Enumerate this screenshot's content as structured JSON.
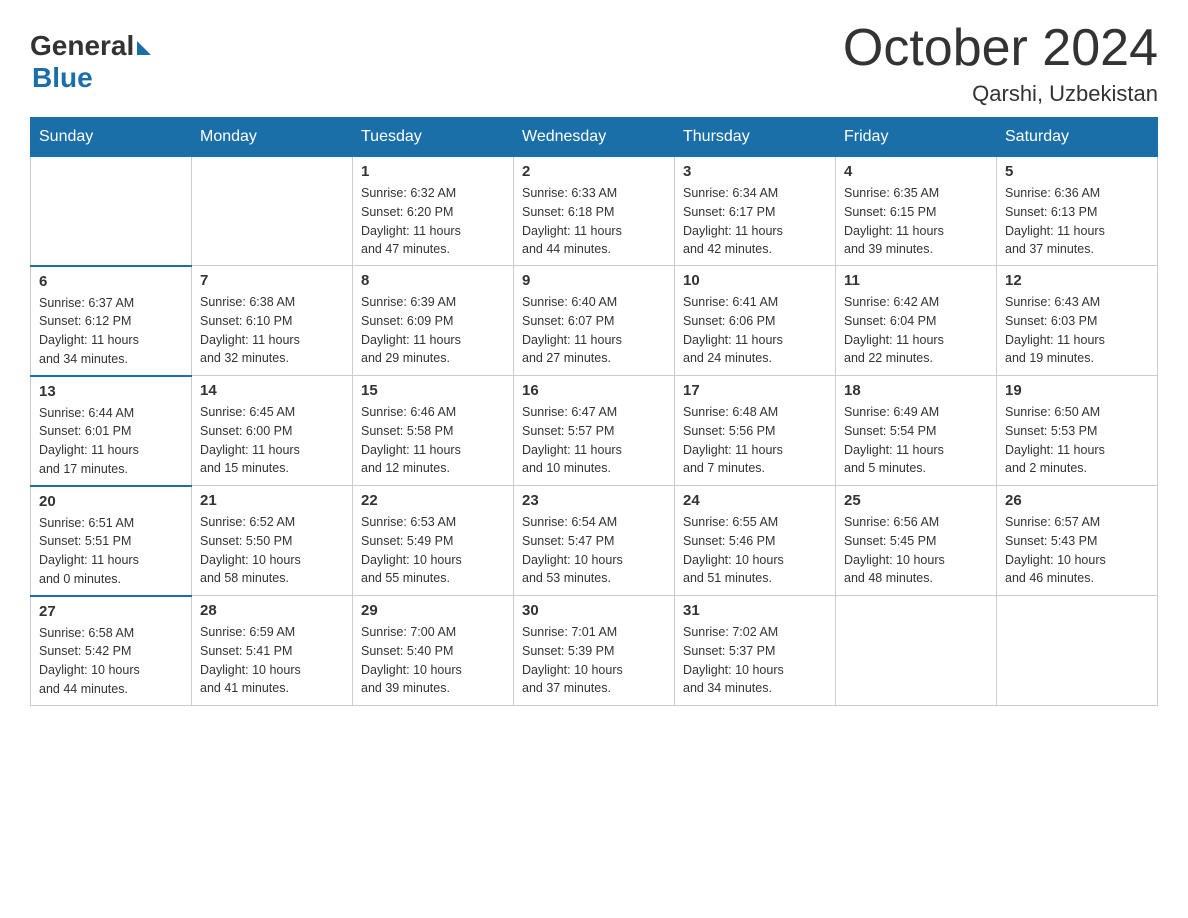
{
  "header": {
    "logo_general": "General",
    "logo_blue": "Blue",
    "month_title": "October 2024",
    "location": "Qarshi, Uzbekistan"
  },
  "days_of_week": [
    "Sunday",
    "Monday",
    "Tuesday",
    "Wednesday",
    "Thursday",
    "Friday",
    "Saturday"
  ],
  "weeks": [
    [
      {
        "day": "",
        "info": ""
      },
      {
        "day": "",
        "info": ""
      },
      {
        "day": "1",
        "info": "Sunrise: 6:32 AM\nSunset: 6:20 PM\nDaylight: 11 hours\nand 47 minutes."
      },
      {
        "day": "2",
        "info": "Sunrise: 6:33 AM\nSunset: 6:18 PM\nDaylight: 11 hours\nand 44 minutes."
      },
      {
        "day": "3",
        "info": "Sunrise: 6:34 AM\nSunset: 6:17 PM\nDaylight: 11 hours\nand 42 minutes."
      },
      {
        "day": "4",
        "info": "Sunrise: 6:35 AM\nSunset: 6:15 PM\nDaylight: 11 hours\nand 39 minutes."
      },
      {
        "day": "5",
        "info": "Sunrise: 6:36 AM\nSunset: 6:13 PM\nDaylight: 11 hours\nand 37 minutes."
      }
    ],
    [
      {
        "day": "6",
        "info": "Sunrise: 6:37 AM\nSunset: 6:12 PM\nDaylight: 11 hours\nand 34 minutes."
      },
      {
        "day": "7",
        "info": "Sunrise: 6:38 AM\nSunset: 6:10 PM\nDaylight: 11 hours\nand 32 minutes."
      },
      {
        "day": "8",
        "info": "Sunrise: 6:39 AM\nSunset: 6:09 PM\nDaylight: 11 hours\nand 29 minutes."
      },
      {
        "day": "9",
        "info": "Sunrise: 6:40 AM\nSunset: 6:07 PM\nDaylight: 11 hours\nand 27 minutes."
      },
      {
        "day": "10",
        "info": "Sunrise: 6:41 AM\nSunset: 6:06 PM\nDaylight: 11 hours\nand 24 minutes."
      },
      {
        "day": "11",
        "info": "Sunrise: 6:42 AM\nSunset: 6:04 PM\nDaylight: 11 hours\nand 22 minutes."
      },
      {
        "day": "12",
        "info": "Sunrise: 6:43 AM\nSunset: 6:03 PM\nDaylight: 11 hours\nand 19 minutes."
      }
    ],
    [
      {
        "day": "13",
        "info": "Sunrise: 6:44 AM\nSunset: 6:01 PM\nDaylight: 11 hours\nand 17 minutes."
      },
      {
        "day": "14",
        "info": "Sunrise: 6:45 AM\nSunset: 6:00 PM\nDaylight: 11 hours\nand 15 minutes."
      },
      {
        "day": "15",
        "info": "Sunrise: 6:46 AM\nSunset: 5:58 PM\nDaylight: 11 hours\nand 12 minutes."
      },
      {
        "day": "16",
        "info": "Sunrise: 6:47 AM\nSunset: 5:57 PM\nDaylight: 11 hours\nand 10 minutes."
      },
      {
        "day": "17",
        "info": "Sunrise: 6:48 AM\nSunset: 5:56 PM\nDaylight: 11 hours\nand 7 minutes."
      },
      {
        "day": "18",
        "info": "Sunrise: 6:49 AM\nSunset: 5:54 PM\nDaylight: 11 hours\nand 5 minutes."
      },
      {
        "day": "19",
        "info": "Sunrise: 6:50 AM\nSunset: 5:53 PM\nDaylight: 11 hours\nand 2 minutes."
      }
    ],
    [
      {
        "day": "20",
        "info": "Sunrise: 6:51 AM\nSunset: 5:51 PM\nDaylight: 11 hours\nand 0 minutes."
      },
      {
        "day": "21",
        "info": "Sunrise: 6:52 AM\nSunset: 5:50 PM\nDaylight: 10 hours\nand 58 minutes."
      },
      {
        "day": "22",
        "info": "Sunrise: 6:53 AM\nSunset: 5:49 PM\nDaylight: 10 hours\nand 55 minutes."
      },
      {
        "day": "23",
        "info": "Sunrise: 6:54 AM\nSunset: 5:47 PM\nDaylight: 10 hours\nand 53 minutes."
      },
      {
        "day": "24",
        "info": "Sunrise: 6:55 AM\nSunset: 5:46 PM\nDaylight: 10 hours\nand 51 minutes."
      },
      {
        "day": "25",
        "info": "Sunrise: 6:56 AM\nSunset: 5:45 PM\nDaylight: 10 hours\nand 48 minutes."
      },
      {
        "day": "26",
        "info": "Sunrise: 6:57 AM\nSunset: 5:43 PM\nDaylight: 10 hours\nand 46 minutes."
      }
    ],
    [
      {
        "day": "27",
        "info": "Sunrise: 6:58 AM\nSunset: 5:42 PM\nDaylight: 10 hours\nand 44 minutes."
      },
      {
        "day": "28",
        "info": "Sunrise: 6:59 AM\nSunset: 5:41 PM\nDaylight: 10 hours\nand 41 minutes."
      },
      {
        "day": "29",
        "info": "Sunrise: 7:00 AM\nSunset: 5:40 PM\nDaylight: 10 hours\nand 39 minutes."
      },
      {
        "day": "30",
        "info": "Sunrise: 7:01 AM\nSunset: 5:39 PM\nDaylight: 10 hours\nand 37 minutes."
      },
      {
        "day": "31",
        "info": "Sunrise: 7:02 AM\nSunset: 5:37 PM\nDaylight: 10 hours\nand 34 minutes."
      },
      {
        "day": "",
        "info": ""
      },
      {
        "day": "",
        "info": ""
      }
    ]
  ]
}
